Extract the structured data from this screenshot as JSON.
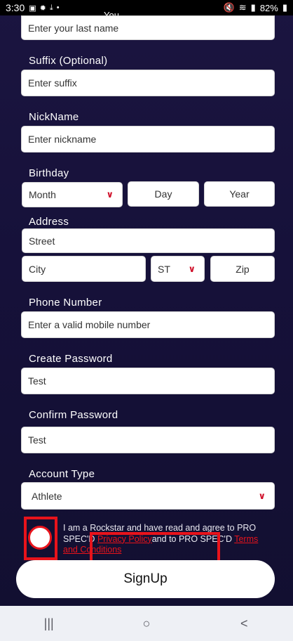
{
  "status_bar": {
    "time": "3:30",
    "center_label": "You",
    "battery": "82%",
    "left_icons": [
      "gallery-icon",
      "brightness-icon",
      "download-icon",
      "dot-icon"
    ],
    "right_icons": [
      "mute-icon",
      "wifi-icon",
      "signal-icon",
      "battery-icon"
    ]
  },
  "form": {
    "last_name_placeholder": "Enter your last name",
    "suffix_label": "Suffix (Optional)",
    "suffix_placeholder": "Enter suffix",
    "nickname_label": "NickName",
    "nickname_placeholder": "Enter nickname",
    "birthday_label": "Birthday",
    "month": "Month",
    "day": "Day",
    "year": "Year",
    "address_label": "Address",
    "street": "Street",
    "city": "City",
    "state": "ST",
    "zip": "Zip",
    "phone_label": "Phone Number",
    "phone_placeholder": "Enter a valid mobile number",
    "password_label": "Create Password",
    "password_value": "Test",
    "confirm_label": "Confirm Password",
    "confirm_value": "Test",
    "account_type_label": "Account Type",
    "account_type_value": "Athlete"
  },
  "agreement": {
    "text_1": "I am a Rockstar and have read and agree to PRO SPEC'D ",
    "privacy_link": "Privacy Policy",
    "text_2": "and to PRO SPEC'D ",
    "terms_link": "Terms and Conditions"
  },
  "signup_button": "SignUp",
  "nav": {
    "recent": "|||",
    "home": "○",
    "back": "<"
  }
}
